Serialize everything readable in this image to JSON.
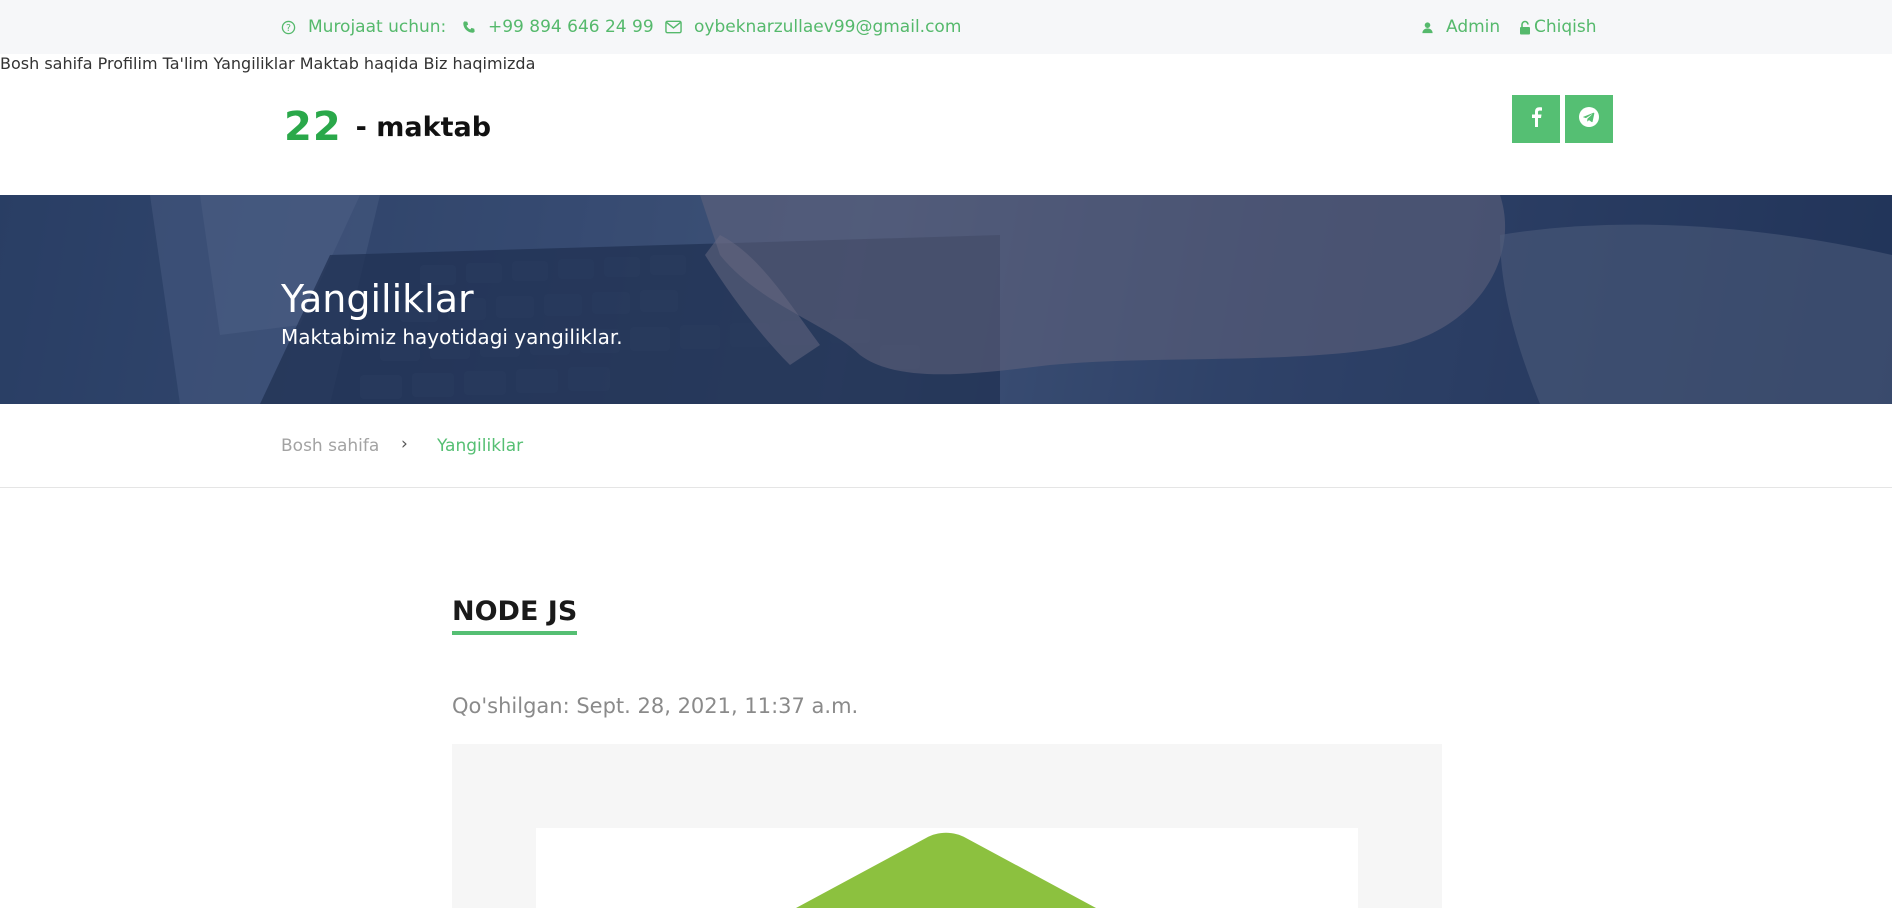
{
  "topbar": {
    "contact_label": "Murojaat uchun:",
    "phone": "+99 894 646 24 99",
    "email": "oybeknarzullaev99@gmail.com",
    "admin_label": "Admin",
    "logout_label": "Chiqish",
    "icons": [
      "question-circle-icon",
      "phone-icon",
      "envelope-icon",
      "user-icon",
      "unlock-icon"
    ]
  },
  "logo": {
    "number": "22",
    "text": "- maktab"
  },
  "nav": {
    "items": [
      "Bosh sahifa",
      "Profilim",
      "Ta'lim",
      "Yangiliklar",
      "Maktab haqida",
      "Biz haqimizda"
    ]
  },
  "social": {
    "icons": [
      "facebook-icon",
      "telegram-icon"
    ]
  },
  "banner": {
    "title": "Yangiliklar",
    "subtitle": "Maktabimiz hayotidagi yangiliklar."
  },
  "breadcrumb": {
    "home": "Bosh sahifa",
    "separator": "›",
    "current": "Yangiliklar"
  },
  "article": {
    "title": "NODE JS",
    "date": "Qo'shilgan: Sept. 28, 2021, 11:37 a.m."
  },
  "colors": {
    "accent": "#55bf73",
    "topbar_bg": "#f6f7f9",
    "banner_overlay": "#1e3560"
  }
}
